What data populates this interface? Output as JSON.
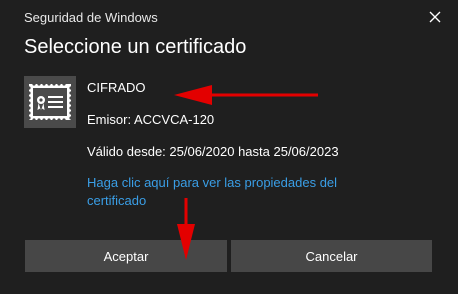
{
  "window": {
    "title": "Seguridad de Windows"
  },
  "dialog": {
    "heading": "Seleccione un certificado",
    "certificate": {
      "name": "CIFRADO",
      "issuer": "Emisor: ACCVCA-120",
      "validity": "Válido desde: 25/06/2020 hasta 25/06/2023",
      "properties_link": "Haga clic aquí para ver las propiedades del certificado",
      "icon": "certificate-icon"
    },
    "buttons": {
      "accept": "Aceptar",
      "cancel": "Cancelar"
    }
  },
  "colors": {
    "background": "#1f1f1f",
    "button": "#474747",
    "link": "#3a9ee6",
    "annotation_arrow": "#e30000"
  }
}
